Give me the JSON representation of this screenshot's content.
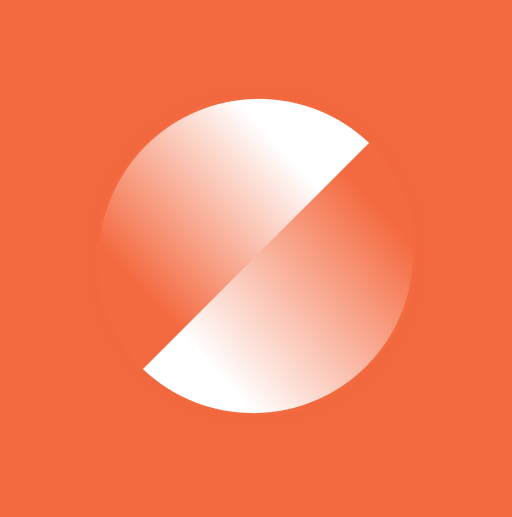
{
  "app_icon": {
    "name": "app-logo",
    "icon": "split-circle-logo",
    "colors": {
      "background": "#F46A40",
      "highlight": "#FFFFFF",
      "shade": "#F46A40"
    }
  }
}
